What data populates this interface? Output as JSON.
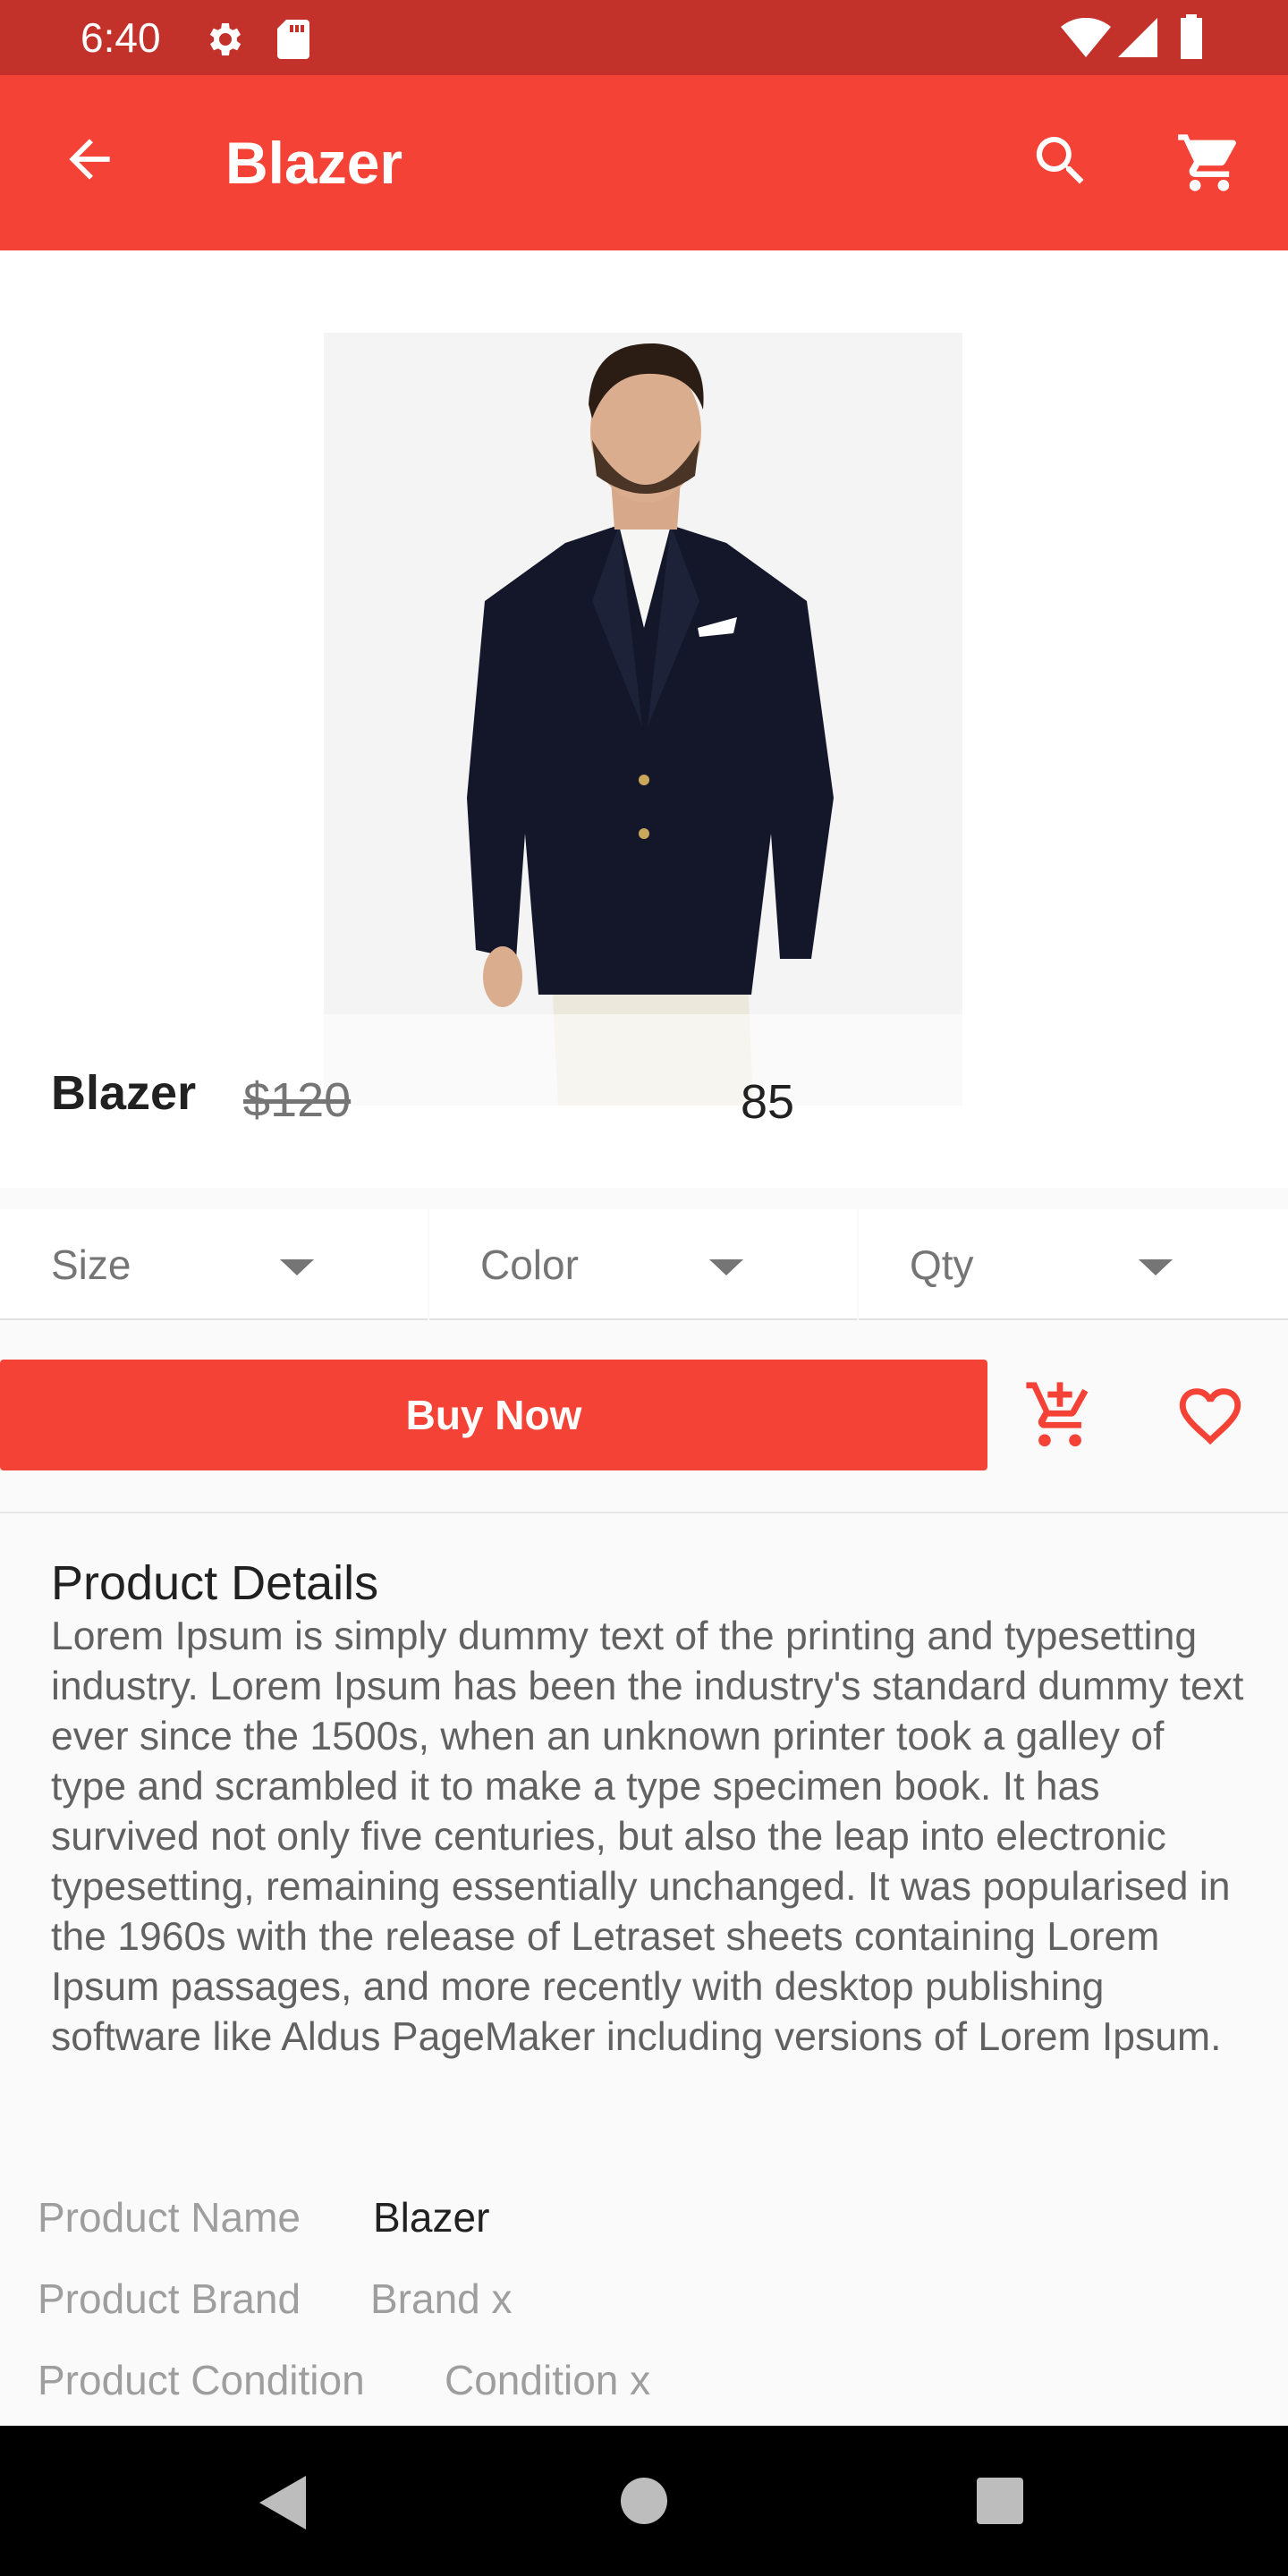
{
  "status_bar": {
    "time": "6:40"
  },
  "app_bar": {
    "title": "Blazer"
  },
  "product": {
    "name": "Blazer",
    "old_price": "$120",
    "price": "85"
  },
  "selectors": [
    {
      "label": "Size"
    },
    {
      "label": "Color"
    },
    {
      "label": "Qty"
    }
  ],
  "actions": {
    "buy_label": "Buy Now"
  },
  "details": {
    "title": "Product Details",
    "body": "Lorem Ipsum is simply dummy text of the printing and typesetting industry. Lorem Ipsum has been the industry's standard dummy text ever since the 1500s, when an unknown printer took a galley of type and scrambled it to make a type specimen book. It has survived not only five centuries, but also the leap into electronic typesetting, remaining essentially unchanged. It was popularised in the 1960s with the release of Letraset sheets containing Lorem Ipsum passages, and more recently with desktop publishing software like Aldus PageMaker including versions of Lorem Ipsum."
  },
  "specs": [
    {
      "label": "Product Name",
      "value": "Blazer"
    },
    {
      "label": "Product Brand",
      "value": "Brand x"
    },
    {
      "label": "Product Condition",
      "value": "Condition x"
    }
  ],
  "colors": {
    "primary": "#f44336",
    "status_bar": "#c2312a"
  },
  "icons": {
    "status": [
      "gear-icon",
      "sd-card-icon",
      "wifi-icon",
      "signal-icon",
      "battery-icon"
    ],
    "app_bar": [
      "back-arrow-icon",
      "search-icon",
      "cart-icon"
    ],
    "actions": [
      "add-to-cart-icon",
      "heart-icon"
    ],
    "nav": [
      "nav-back-icon",
      "nav-home-icon",
      "nav-recents-icon"
    ]
  }
}
